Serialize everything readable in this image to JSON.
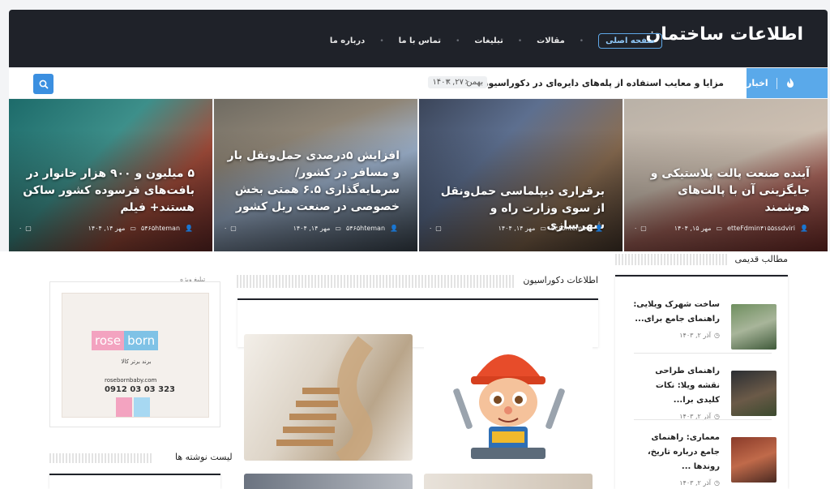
{
  "header": {
    "logo": "اطلاعات ساختمان",
    "nav": [
      "صفحه اصلی",
      "مقالات",
      "تبلیغات",
      "تماس با ما",
      "درباره ما"
    ]
  },
  "ticker": {
    "label": "اخبار",
    "text": "مزایا و معایب استفاده از پله‌های دایره‌ای در دکوراسیون داخلی",
    "date": "بهمن ۲۷, ۱۴۰۳",
    "arrows": "‹ ›"
  },
  "hero": [
    {
      "title": "آینده صنعت پالت پلاستیکی و جایگزینی آن با پالت‌های هوشمند",
      "author": "etteFdmin۴۱۵۵ssdviri",
      "date": "مهر ۱۵, ۱۴۰۴",
      "comments": "۰"
    },
    {
      "title": "برقراری دیپلماسی حمل‌ونقل از سوی وزارت راه و شهرسازی",
      "author": "۵۴۶۵hteman",
      "date": "مهر ۱۴, ۱۴۰۴",
      "comments": "۰"
    },
    {
      "title": "افزایش ۵درصدی حمل‌ونقل بار و مسافر در کشور/ سرمایه‌گذاری ۶.۵ همتی بخش خصوصی در صنعت ریل کشور",
      "author": "۵۴۶۵hteman",
      "date": "مهر ۱۴, ۱۴۰۴",
      "comments": "۰"
    },
    {
      "title": "۵ میلیون و ۹۰۰ هزار خانوار در بافت‌های فرسوده کشور ساکن هستند+ فیلم",
      "author": "۵۴۶۵hteman",
      "date": "مهر ۱۴, ۱۴۰۴",
      "comments": "۰"
    }
  ],
  "old_posts": {
    "title": "مطالب قدیمی",
    "items": [
      {
        "title": "ساخت شهرک ویلایی: راهنمای جامع برای...",
        "date": "آذر ۲, ۱۴۰۳"
      },
      {
        "title": "راهنمای طراحی نقشه ویلا: نکات کلیدی برا...",
        "date": "آذر ۲, ۱۴۰۳"
      },
      {
        "title": "معماری: راهنمای جامع درباره تاریخ، روندها ...",
        "date": "آذر ۲, ۱۴۰۳"
      }
    ]
  },
  "decor": {
    "title": "اطلاعات دکوراسیون"
  },
  "ad": {
    "label": "تبلیغ ویژه",
    "logo_left": "rose",
    "logo_right": "born",
    "tagline": "برند برتر کالا",
    "site": "rosebornbaby.com",
    "phone": "0912 03 03 323"
  },
  "list": {
    "title": "لیست نوشته ها"
  },
  "colors": {
    "accent": "#5aa9ea",
    "header": "#1f2229",
    "search": "#3b8fe0"
  }
}
